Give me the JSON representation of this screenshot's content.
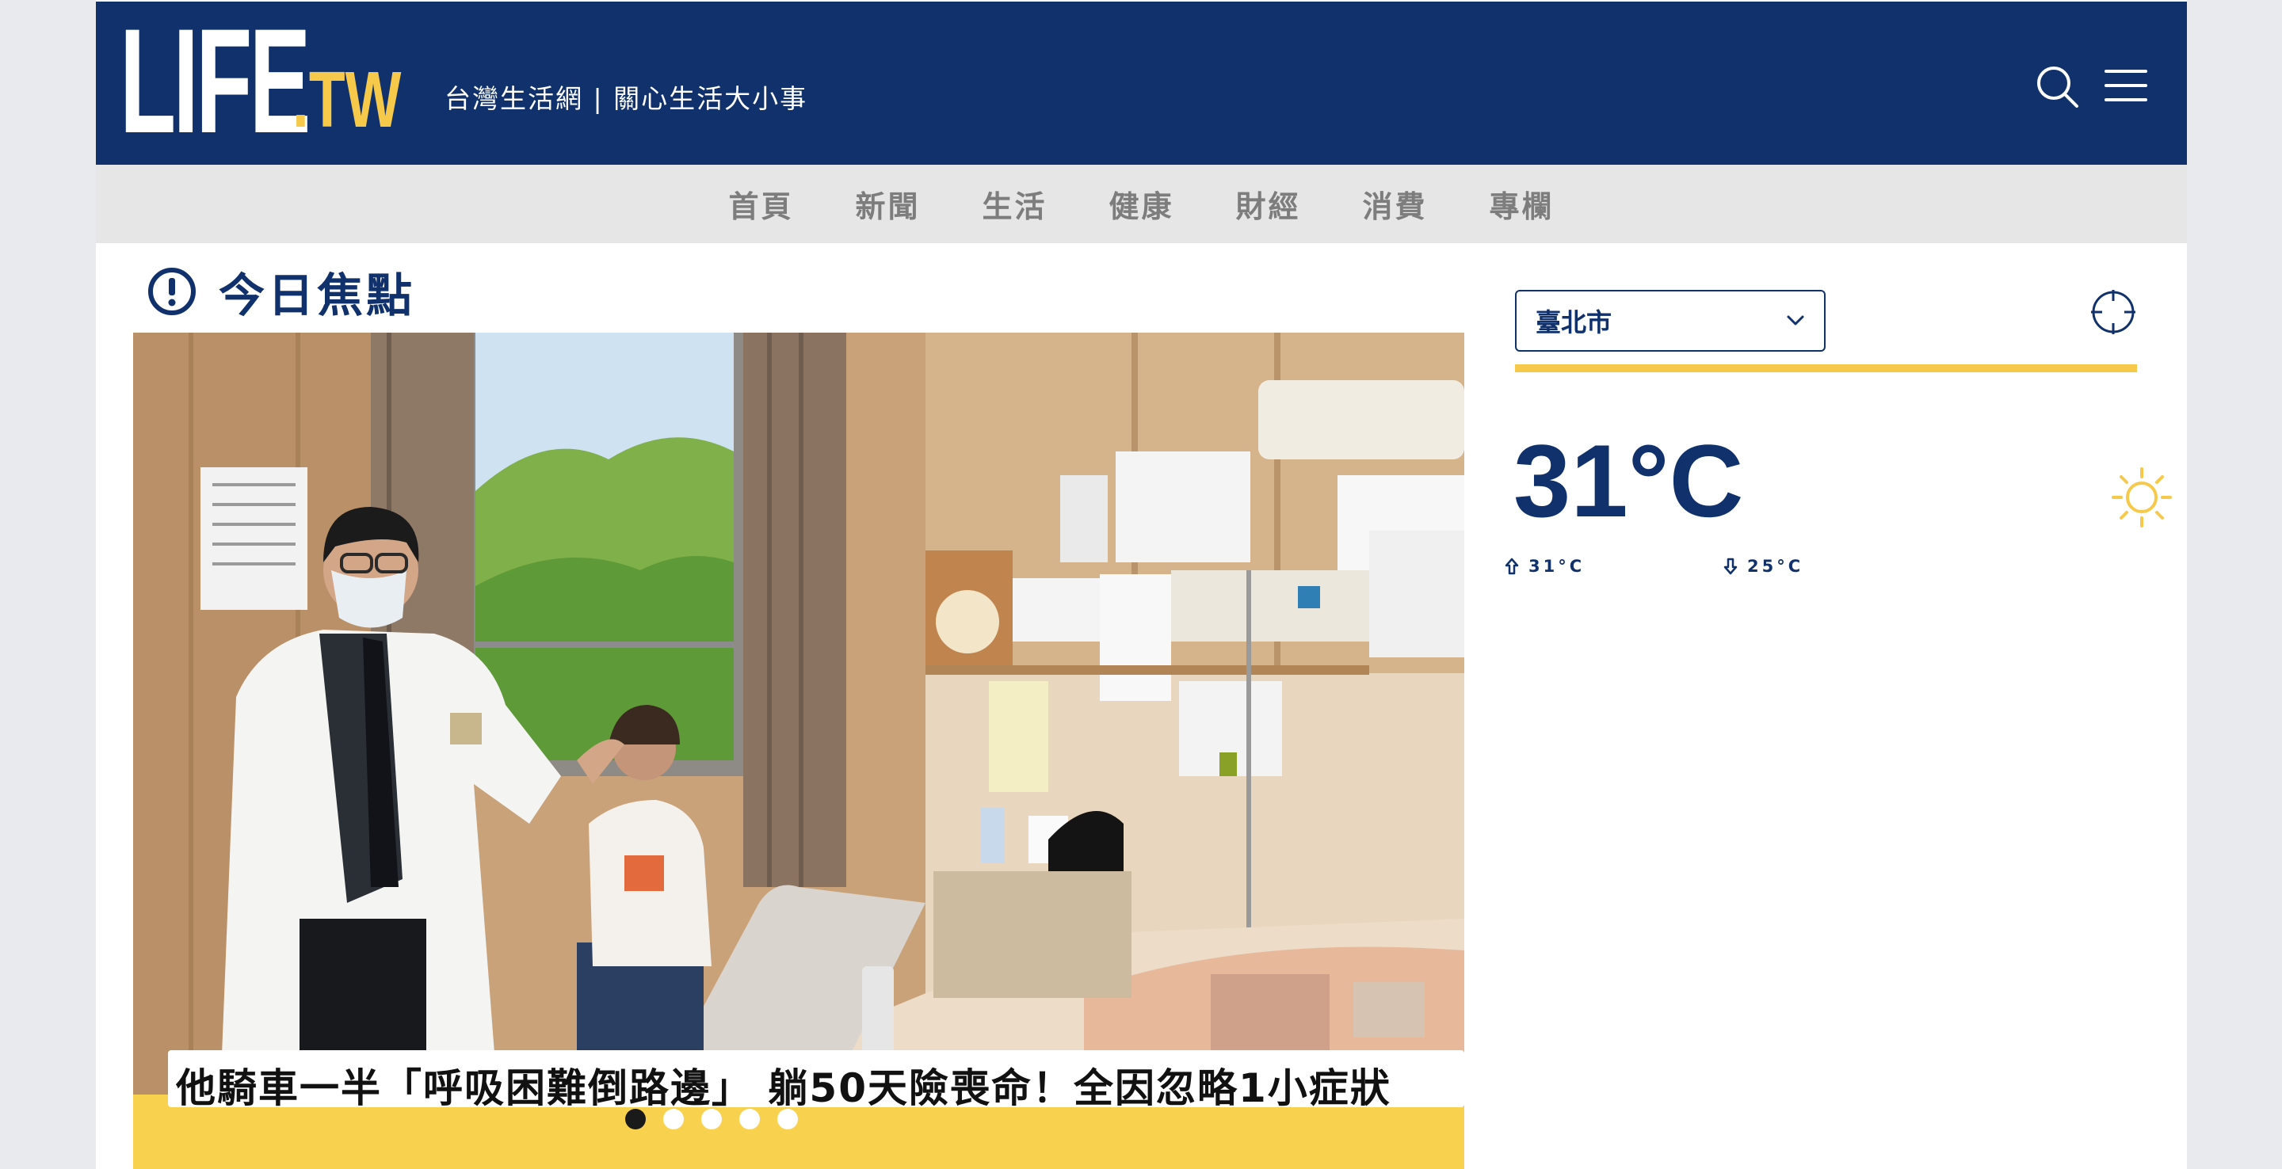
{
  "header": {
    "logo_life": "LIFE",
    "logo_tw": ".TW",
    "tagline": "台灣生活網 | 關心生活大小事",
    "search_icon": "search-icon",
    "menu_icon": "hamburger-menu-icon",
    "background_color": "#10316b",
    "accent_color": "#f6c94a"
  },
  "nav": {
    "items": [
      "首頁",
      "新聞",
      "生活",
      "健康",
      "財經",
      "消費",
      "專欄"
    ]
  },
  "focus": {
    "title": "今日焦點",
    "icon": "exclamation-circle-icon",
    "headline": "他騎車一半「呼吸困難倒路邊」 躺50天險喪命！全因忽略1小症狀",
    "slide_count": 5,
    "active_slide": 1
  },
  "weather": {
    "city": "臺北市",
    "locate_icon": "crosshair-icon",
    "temperature": "31°C",
    "condition_icon": "sun-icon",
    "high": "31°C",
    "low": "25°C"
  }
}
